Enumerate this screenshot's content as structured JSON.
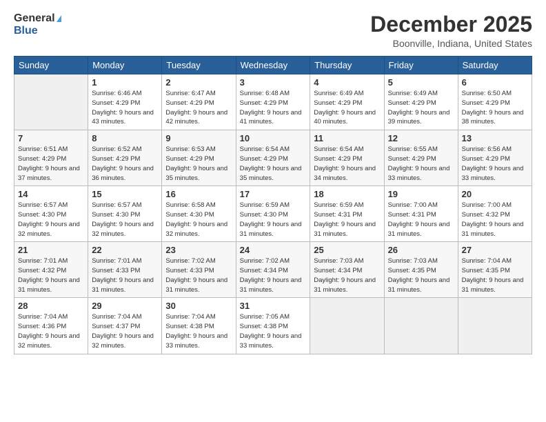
{
  "header": {
    "logo_general": "General",
    "logo_blue": "Blue",
    "month_title": "December 2025",
    "location": "Boonville, Indiana, United States"
  },
  "days_of_week": [
    "Sunday",
    "Monday",
    "Tuesday",
    "Wednesday",
    "Thursday",
    "Friday",
    "Saturday"
  ],
  "weeks": [
    [
      {
        "day": "",
        "sunrise": "",
        "sunset": "",
        "daylight": "",
        "empty": true
      },
      {
        "day": "1",
        "sunrise": "Sunrise: 6:46 AM",
        "sunset": "Sunset: 4:29 PM",
        "daylight": "Daylight: 9 hours and 43 minutes."
      },
      {
        "day": "2",
        "sunrise": "Sunrise: 6:47 AM",
        "sunset": "Sunset: 4:29 PM",
        "daylight": "Daylight: 9 hours and 42 minutes."
      },
      {
        "day": "3",
        "sunrise": "Sunrise: 6:48 AM",
        "sunset": "Sunset: 4:29 PM",
        "daylight": "Daylight: 9 hours and 41 minutes."
      },
      {
        "day": "4",
        "sunrise": "Sunrise: 6:49 AM",
        "sunset": "Sunset: 4:29 PM",
        "daylight": "Daylight: 9 hours and 40 minutes."
      },
      {
        "day": "5",
        "sunrise": "Sunrise: 6:49 AM",
        "sunset": "Sunset: 4:29 PM",
        "daylight": "Daylight: 9 hours and 39 minutes."
      },
      {
        "day": "6",
        "sunrise": "Sunrise: 6:50 AM",
        "sunset": "Sunset: 4:29 PM",
        "daylight": "Daylight: 9 hours and 38 minutes."
      }
    ],
    [
      {
        "day": "7",
        "sunrise": "Sunrise: 6:51 AM",
        "sunset": "Sunset: 4:29 PM",
        "daylight": "Daylight: 9 hours and 37 minutes."
      },
      {
        "day": "8",
        "sunrise": "Sunrise: 6:52 AM",
        "sunset": "Sunset: 4:29 PM",
        "daylight": "Daylight: 9 hours and 36 minutes."
      },
      {
        "day": "9",
        "sunrise": "Sunrise: 6:53 AM",
        "sunset": "Sunset: 4:29 PM",
        "daylight": "Daylight: 9 hours and 35 minutes."
      },
      {
        "day": "10",
        "sunrise": "Sunrise: 6:54 AM",
        "sunset": "Sunset: 4:29 PM",
        "daylight": "Daylight: 9 hours and 35 minutes."
      },
      {
        "day": "11",
        "sunrise": "Sunrise: 6:54 AM",
        "sunset": "Sunset: 4:29 PM",
        "daylight": "Daylight: 9 hours and 34 minutes."
      },
      {
        "day": "12",
        "sunrise": "Sunrise: 6:55 AM",
        "sunset": "Sunset: 4:29 PM",
        "daylight": "Daylight: 9 hours and 33 minutes."
      },
      {
        "day": "13",
        "sunrise": "Sunrise: 6:56 AM",
        "sunset": "Sunset: 4:29 PM",
        "daylight": "Daylight: 9 hours and 33 minutes."
      }
    ],
    [
      {
        "day": "14",
        "sunrise": "Sunrise: 6:57 AM",
        "sunset": "Sunset: 4:30 PM",
        "daylight": "Daylight: 9 hours and 32 minutes."
      },
      {
        "day": "15",
        "sunrise": "Sunrise: 6:57 AM",
        "sunset": "Sunset: 4:30 PM",
        "daylight": "Daylight: 9 hours and 32 minutes."
      },
      {
        "day": "16",
        "sunrise": "Sunrise: 6:58 AM",
        "sunset": "Sunset: 4:30 PM",
        "daylight": "Daylight: 9 hours and 32 minutes."
      },
      {
        "day": "17",
        "sunrise": "Sunrise: 6:59 AM",
        "sunset": "Sunset: 4:30 PM",
        "daylight": "Daylight: 9 hours and 31 minutes."
      },
      {
        "day": "18",
        "sunrise": "Sunrise: 6:59 AM",
        "sunset": "Sunset: 4:31 PM",
        "daylight": "Daylight: 9 hours and 31 minutes."
      },
      {
        "day": "19",
        "sunrise": "Sunrise: 7:00 AM",
        "sunset": "Sunset: 4:31 PM",
        "daylight": "Daylight: 9 hours and 31 minutes."
      },
      {
        "day": "20",
        "sunrise": "Sunrise: 7:00 AM",
        "sunset": "Sunset: 4:32 PM",
        "daylight": "Daylight: 9 hours and 31 minutes."
      }
    ],
    [
      {
        "day": "21",
        "sunrise": "Sunrise: 7:01 AM",
        "sunset": "Sunset: 4:32 PM",
        "daylight": "Daylight: 9 hours and 31 minutes."
      },
      {
        "day": "22",
        "sunrise": "Sunrise: 7:01 AM",
        "sunset": "Sunset: 4:33 PM",
        "daylight": "Daylight: 9 hours and 31 minutes."
      },
      {
        "day": "23",
        "sunrise": "Sunrise: 7:02 AM",
        "sunset": "Sunset: 4:33 PM",
        "daylight": "Daylight: 9 hours and 31 minutes."
      },
      {
        "day": "24",
        "sunrise": "Sunrise: 7:02 AM",
        "sunset": "Sunset: 4:34 PM",
        "daylight": "Daylight: 9 hours and 31 minutes."
      },
      {
        "day": "25",
        "sunrise": "Sunrise: 7:03 AM",
        "sunset": "Sunset: 4:34 PM",
        "daylight": "Daylight: 9 hours and 31 minutes."
      },
      {
        "day": "26",
        "sunrise": "Sunrise: 7:03 AM",
        "sunset": "Sunset: 4:35 PM",
        "daylight": "Daylight: 9 hours and 31 minutes."
      },
      {
        "day": "27",
        "sunrise": "Sunrise: 7:04 AM",
        "sunset": "Sunset: 4:35 PM",
        "daylight": "Daylight: 9 hours and 31 minutes."
      }
    ],
    [
      {
        "day": "28",
        "sunrise": "Sunrise: 7:04 AM",
        "sunset": "Sunset: 4:36 PM",
        "daylight": "Daylight: 9 hours and 32 minutes."
      },
      {
        "day": "29",
        "sunrise": "Sunrise: 7:04 AM",
        "sunset": "Sunset: 4:37 PM",
        "daylight": "Daylight: 9 hours and 32 minutes."
      },
      {
        "day": "30",
        "sunrise": "Sunrise: 7:04 AM",
        "sunset": "Sunset: 4:38 PM",
        "daylight": "Daylight: 9 hours and 33 minutes."
      },
      {
        "day": "31",
        "sunrise": "Sunrise: 7:05 AM",
        "sunset": "Sunset: 4:38 PM",
        "daylight": "Daylight: 9 hours and 33 minutes."
      },
      {
        "day": "",
        "sunrise": "",
        "sunset": "",
        "daylight": "",
        "empty": true
      },
      {
        "day": "",
        "sunrise": "",
        "sunset": "",
        "daylight": "",
        "empty": true
      },
      {
        "day": "",
        "sunrise": "",
        "sunset": "",
        "daylight": "",
        "empty": true
      }
    ]
  ]
}
